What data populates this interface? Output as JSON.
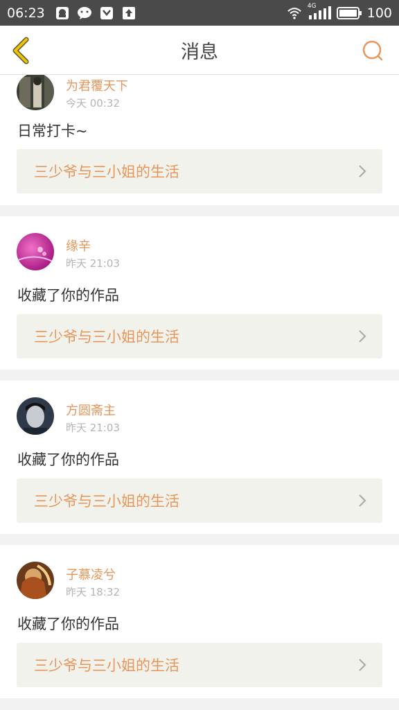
{
  "status_bar": {
    "time": "06:23",
    "network": "4G",
    "battery": "100"
  },
  "nav": {
    "title": "消息"
  },
  "colors": {
    "accent": "#e8955a",
    "back_icon": "#f2c200",
    "status_bg": "#4a4a4a"
  },
  "messages": [
    {
      "user": "为君覆天下",
      "time": "今天 00:32",
      "text": "日常打卡~",
      "work_title": "三少爷与三小姐的生活"
    },
    {
      "user": "缘辛",
      "time": "昨天 21:03",
      "text": "收藏了你的作品",
      "work_title": "三少爷与三小姐的生活"
    },
    {
      "user": "方圆斋主",
      "time": "昨天 21:03",
      "text": "收藏了你的作品",
      "work_title": "三少爷与三小姐的生活"
    },
    {
      "user": "子慕凌兮",
      "time": "昨天 18:32",
      "text": "收藏了你的作品",
      "work_title": "三少爷与三小姐的生活"
    }
  ]
}
